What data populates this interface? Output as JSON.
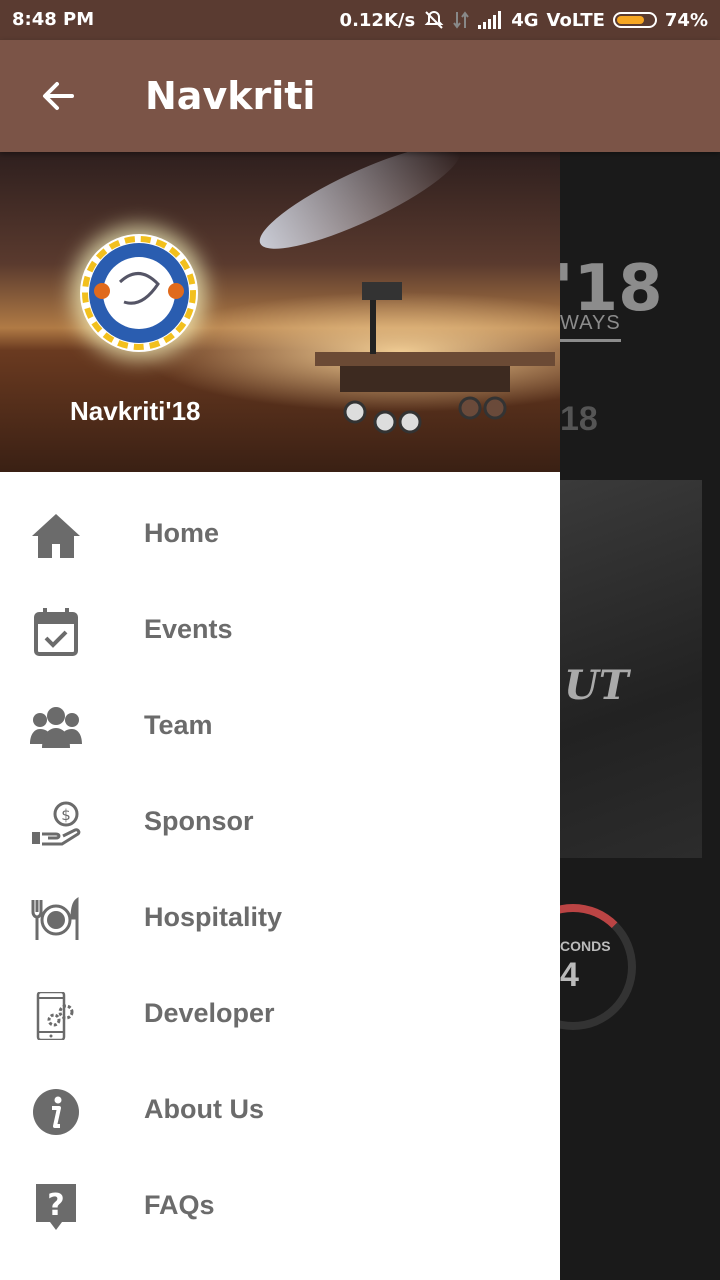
{
  "status_bar": {
    "time": "8:48 PM",
    "speed": "0.12K/s",
    "network": "4G",
    "volte": "VoLTE",
    "battery": "74%",
    "battery_level": 0.74
  },
  "app_bar": {
    "title": "Navkriti"
  },
  "drawer": {
    "header_name": "Navkriti'18",
    "items": [
      {
        "label": "Home",
        "icon": "home-icon"
      },
      {
        "label": "Events",
        "icon": "calendar-check-icon"
      },
      {
        "label": "Team",
        "icon": "group-icon"
      },
      {
        "label": "Sponsor",
        "icon": "money-hand-icon"
      },
      {
        "label": "Hospitality",
        "icon": "dining-icon"
      },
      {
        "label": "Developer",
        "icon": "phone-settings-icon"
      },
      {
        "label": "About Us",
        "icon": "info-icon"
      },
      {
        "label": "FAQs",
        "icon": "help-icon"
      }
    ]
  },
  "background": {
    "year": "'18",
    "ways": "WAYS",
    "year_small": "18",
    "word": "UT",
    "unit": "CONDS",
    "number": "4"
  },
  "colors": {
    "status_bar": "#5a3b31",
    "app_bar": "#7b5447",
    "menu_text": "#6b6b6b"
  }
}
